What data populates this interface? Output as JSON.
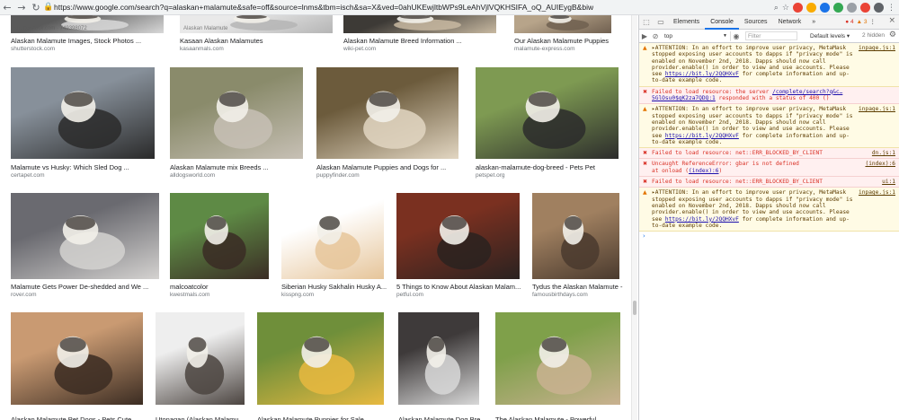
{
  "browser": {
    "url": "https://www.google.com/search?q=alaskan+malamute&safe=off&source=lnms&tbm=isch&sa=X&ved=0ahUKEwjltbWPs9LeAhVjlVQKHSIFA_oQ_AUIEygB&biw=1745&bih=956",
    "back_icon": "←",
    "forward_icon": "→",
    "reload_icon": "↻",
    "lock_icon": "🔒",
    "search_icon": "⌕",
    "star_icon": "☆",
    "menu_icon": "⋮"
  },
  "results": [
    {
      "caption": "Alaskan Malamute Images, Stock Photos ...",
      "source": "shutterstock.com",
      "colors": [
        "#5a5a5a",
        "#d8d8d8"
      ],
      "watermark": "shutterstock.com · 749398072"
    },
    {
      "caption": "Kasaan Alaskan Malamutes",
      "source": "kasaanmals.com",
      "colors": [
        "#e9e9e9",
        "#b5b5b5"
      ],
      "watermark": "Alaskan Malamute"
    },
    {
      "caption": "Alaskan Malamute Breed Information ...",
      "source": "wiki-pet.com",
      "colors": [
        "#3d3a36",
        "#c8b9a1"
      ],
      "watermark": ""
    },
    {
      "caption": "Our Alaskan Malamute Puppies",
      "source": "malamute-express.com",
      "colors": [
        "#b7a48a",
        "#706050"
      ],
      "watermark": ""
    },
    {
      "caption": "Malamute vs Husky: Which Sled Dog ...",
      "source": "certapet.com",
      "colors": [
        "#87909a",
        "#2a2a2a"
      ],
      "watermark": ""
    },
    {
      "caption": "Alaskan Malamute mix Breeds ...",
      "source": "alldogsworld.com",
      "colors": [
        "#8a8b6b",
        "#c7c0b5"
      ],
      "watermark": ""
    },
    {
      "caption": "Alaskan Malamute Puppies and Dogs for ...",
      "source": "puppyfinder.com",
      "colors": [
        "#6c5b3c",
        "#e2d6c2"
      ],
      "watermark": ""
    },
    {
      "caption": "alaskan-malamute-dog-breed - Pets Pet",
      "source": "petspet.org",
      "colors": [
        "#7e9a52",
        "#2c2c2c"
      ],
      "watermark": ""
    },
    {
      "caption": "Malamute Gets Power De-shedded and We ...",
      "source": "rover.com",
      "colors": [
        "#6a6a70",
        "#d4d2d0"
      ],
      "watermark": ""
    },
    {
      "caption": "malcoatcolor",
      "source": "kwestmals.com",
      "colors": [
        "#5e8a45",
        "#3a2c24"
      ],
      "watermark": ""
    },
    {
      "caption": "Siberian Husky Sakhalin Husky A...",
      "source": "kisspng.com",
      "colors": [
        "#ffffff",
        "#e6c59a"
      ],
      "watermark": ""
    },
    {
      "caption": "5 Things to Know About Alaskan Malam...",
      "source": "petful.com",
      "colors": [
        "#7a3020",
        "#2a2220"
      ],
      "watermark": ""
    },
    {
      "caption": "Tydus the Alaskan Malamute -",
      "source": "famousbirthdays.com",
      "colors": [
        "#a08060",
        "#4a3a2e"
      ],
      "watermark": ""
    },
    {
      "caption": "Alaskan Malamute Pet Dogs - Pets Cute ...",
      "source": "",
      "colors": [
        "#c99a72",
        "#3b2c22"
      ],
      "watermark": ""
    },
    {
      "caption": "Utonagan (Alaskan Malamu...",
      "source": "",
      "colors": [
        "#eeeeee",
        "#4b4440"
      ],
      "watermark": ""
    },
    {
      "caption": "Alaskan Malamute Puppies for Sale ...",
      "source": "",
      "colors": [
        "#6f8f3a",
        "#e7b940"
      ],
      "watermark": ""
    },
    {
      "caption": "Alaskan Malamute Dog Bre...",
      "source": "",
      "colors": [
        "#3e3a3a",
        "#d8d8d8"
      ],
      "watermark": ""
    },
    {
      "caption": "The Alaskan Malamute - Powerful ...",
      "source": "",
      "colors": [
        "#7fa04a",
        "#c9b190"
      ],
      "watermark": ""
    }
  ],
  "devtools": {
    "tabs": [
      "Elements",
      "Console",
      "Sources",
      "Network"
    ],
    "more_tabs": "»",
    "error_count": "4",
    "warning_count": "3",
    "inspect_icon": "⬚",
    "device_icon": "▭",
    "close_icon": "×",
    "more_icon": "⋮",
    "context": "top",
    "context_caret": "▼",
    "eye_icon": "◉",
    "clear_icon": "⊘",
    "sidebar_icon": "▶",
    "filter_placeholder": "Filter",
    "levels": "Default levels ▾",
    "hidden_count": "2 hidden",
    "gear_icon": "⚙",
    "prompt": "›",
    "messages": [
      {
        "level": "warn",
        "icon": "▲",
        "text": "▸ATTENTION: In an effort to improve user privacy, MetaMask stopped exposing user accounts to dapps if \"privacy mode\" is enabled on November 2nd, 2018. Dapps should now call provider.enable() in order to view and use accounts. Please see ",
        "link": "https://bit.ly/2QQHXvF",
        "tail": " for complete information and up-to-date example code.",
        "source": "inpage.js:1"
      },
      {
        "level": "error",
        "icon": "✖",
        "text": "Failed to load resource: the server ",
        "link": "/complete/search?q&c…5GlOsu0$gK2za7QDQ:1",
        "tail": " responded with a status of 400 ()",
        "source": ""
      },
      {
        "level": "warn",
        "icon": "▲",
        "text": "▸ATTENTION: In an effort to improve user privacy, MetaMask stopped exposing user accounts to dapps if \"privacy mode\" is enabled on November 2nd, 2018. Dapps should now call provider.enable() in order to view and use accounts. Please see ",
        "link": "https://bit.ly/2QQHXvF",
        "tail": " for complete information and up-to-date example code.",
        "source": "inpage.js:1"
      },
      {
        "level": "error",
        "icon": "✖",
        "text": "Failed to load resource: net::ERR_BLOCKED_BY_CLIENT",
        "link": "",
        "tail": "",
        "source": "dn.js:1"
      },
      {
        "level": "error",
        "icon": "✖",
        "text": "Uncaught ReferenceError: gbar is not defined\n    at onload (",
        "link": "(index):6",
        "tail": ")",
        "source": "(index):6"
      },
      {
        "level": "error",
        "icon": "✖",
        "text": "Failed to load resource: net::ERR_BLOCKED_BY_CLIENT",
        "link": "",
        "tail": "",
        "source": "ui:1"
      },
      {
        "level": "warn",
        "icon": "▲",
        "text": "▸ATTENTION: In an effort to improve user privacy, MetaMask stopped exposing user accounts to dapps if \"privacy mode\" is enabled on November 2nd, 2018. Dapps should now call provider.enable() in order to view and use accounts. Please see ",
        "link": "https://bit.ly/2QQHXvF",
        "tail": " for complete information and up-to-date example code.",
        "source": "inpage.js:1"
      }
    ]
  },
  "colors": {
    "accent": "#1a73e8",
    "error": "#d93025",
    "warning": "#e37400",
    "extensions": [
      "#ea4335",
      "#f9ab00",
      "#1a73e8",
      "#34a853",
      "#9aa0a6",
      "#ea4335",
      "#5f6368"
    ]
  }
}
